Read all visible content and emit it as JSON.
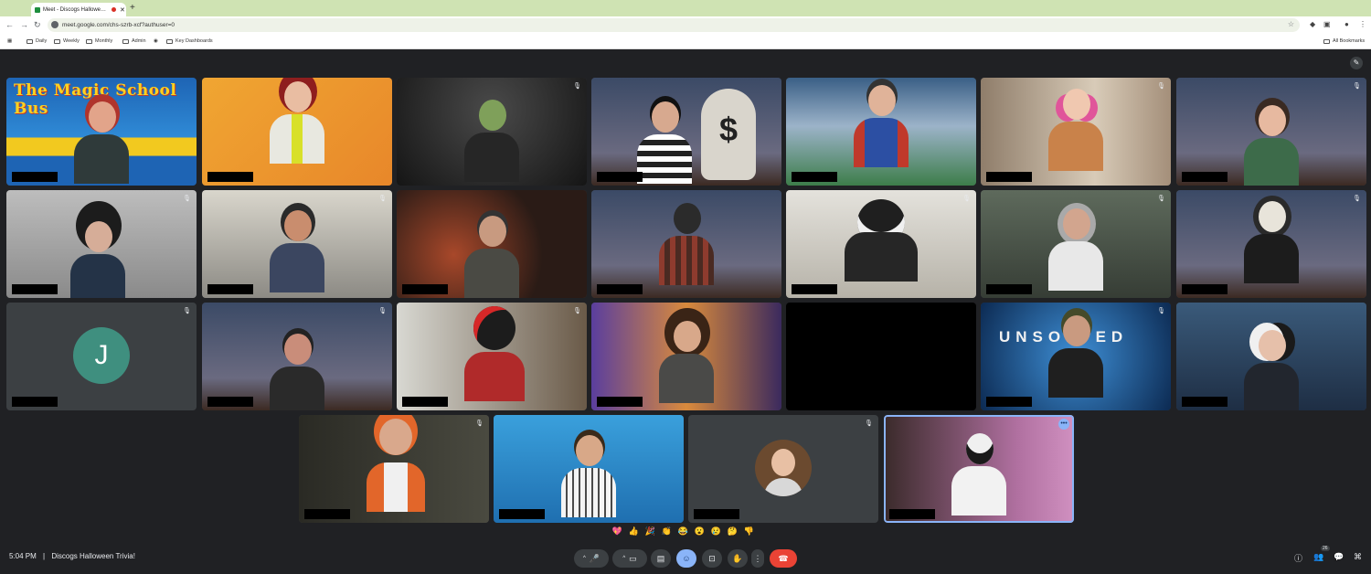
{
  "browser": {
    "tab_title": "Meet - Discogs Hallowe…",
    "url": "meet.google.com/chs-szrb-xcf?authuser=0",
    "bookmarks": [
      "Daily",
      "Weekly",
      "Monthly",
      "Admin",
      "Key Dashboards"
    ],
    "all_bookmarks": "All Bookmarks"
  },
  "tiles_text": {
    "magic_school_bus": "The Magic School Bus",
    "avatar_letter": "J",
    "unsolved": "UNSOLVED"
  },
  "bottom": {
    "time": "5:04 PM",
    "separator": "|",
    "meeting_title": "Discogs Halloween Trivia!",
    "participant_count": "26"
  },
  "reactions": [
    "💖",
    "👍",
    "🎉",
    "👏",
    "😂",
    "😮",
    "😢",
    "🤔",
    "👎"
  ],
  "colors": {
    "meet_bg": "#202124",
    "end_call": "#ea4335",
    "accent": "#8ab4f8",
    "tab_strip": "#cfe3b3"
  }
}
